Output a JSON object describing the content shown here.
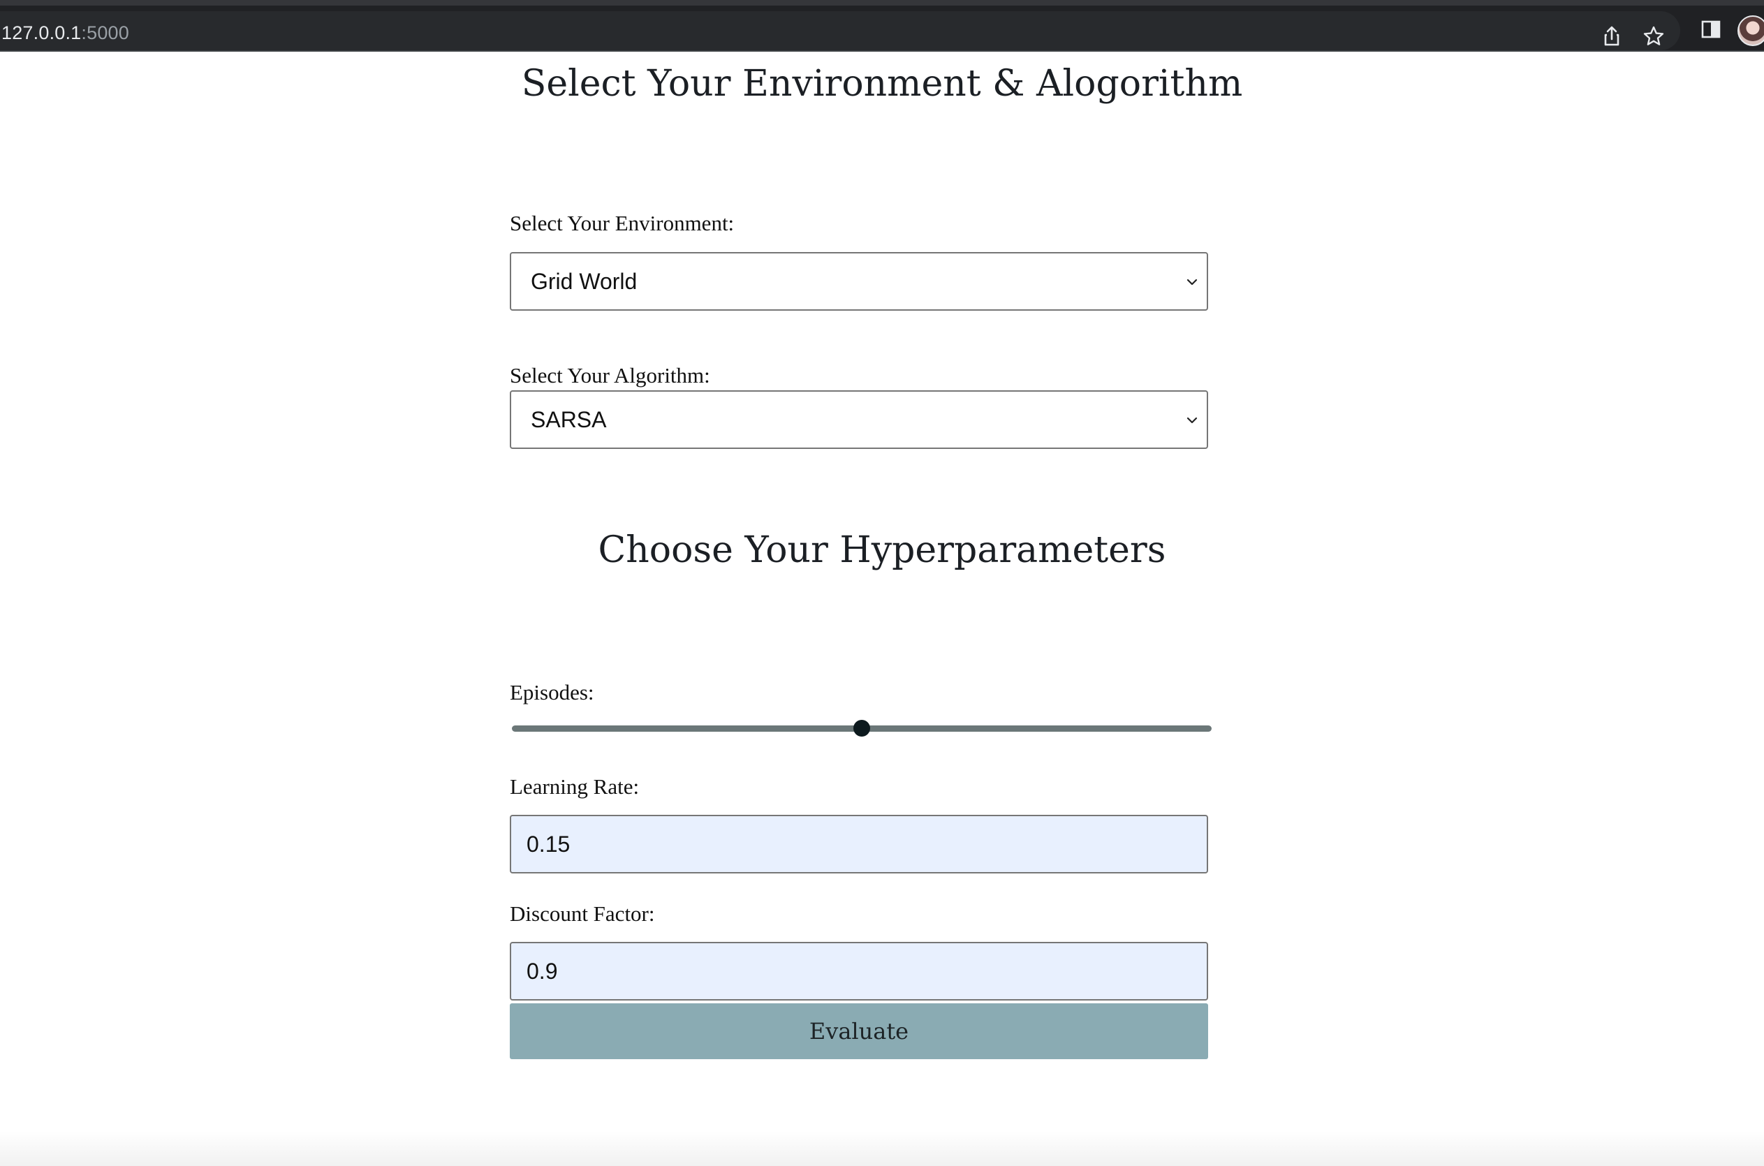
{
  "browser": {
    "url_host": "127.0.0.1",
    "url_port": ":5000",
    "icons": [
      "share-icon",
      "star-icon",
      "side-panel-icon",
      "profile-avatar"
    ]
  },
  "section1": {
    "title": "Select Your Environment & Alogorithm",
    "environment": {
      "label": "Select Your Environment:",
      "value": "Grid World"
    },
    "algorithm": {
      "label": "Select Your Algorithm:",
      "value": "SARSA"
    }
  },
  "section2": {
    "title": "Choose Your Hyperparameters",
    "episodes": {
      "label": "Episodes:",
      "fraction": 0.5
    },
    "learning_rate": {
      "label": "Learning Rate:",
      "value": "0.15"
    },
    "discount_factor": {
      "label": "Discount Factor:",
      "value": "0.9"
    },
    "submit_label": "Evaluate"
  },
  "colors": {
    "button": "#8aabb3",
    "input_autofill": "#e8f0fe",
    "slider_track": "#6b7778",
    "slider_thumb": "#0d1a1e"
  }
}
